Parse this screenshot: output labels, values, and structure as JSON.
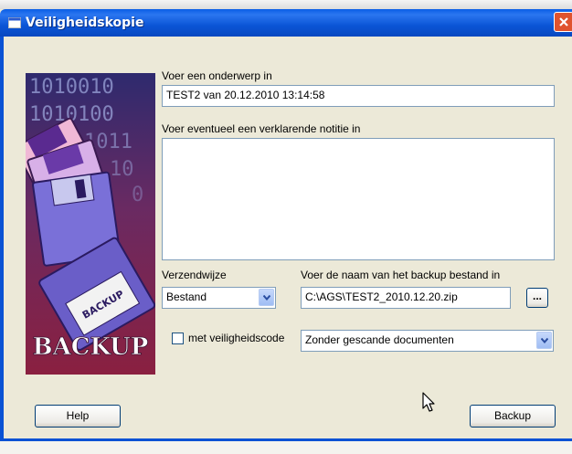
{
  "window": {
    "title": "Veiligheidskopie"
  },
  "form": {
    "subject_label": "Voer een onderwerp in",
    "subject_value": "TEST2 van 20.12.2010 13:14:58",
    "note_label": "Voer eventueel een verklarende notitie in",
    "note_value": "",
    "method_label": "Verzendwijze",
    "method_value": "Bestand",
    "filename_label": "Voer de naam van het backup bestand in",
    "filename_value": "C:\\AGS\\TEST2_2010.12.20.zip",
    "browse_label": "...",
    "security_checkbox_label": "met veiligheidscode",
    "security_checked": false,
    "scan_option_value": "Zonder gescande documenten"
  },
  "art": {
    "binary_row1": "1010010",
    "binary_row2": "1010100",
    "binary_row3": "1011",
    "binary_row4": "10",
    "binary_row5": "0",
    "disk_label": "BACKUP",
    "banner_text": "BACKUP"
  },
  "buttons": {
    "help_label": "Help",
    "backup_label": "Backup"
  },
  "colors": {
    "titlebar": "#0b55d6",
    "art_background": "#7a2140",
    "art_banner": "#ffffff"
  },
  "icons": {
    "title_icon": "window-icon",
    "close_icon": "close-icon",
    "dropdown_icon": "chevron-down-icon",
    "cursor_icon": "mouse-pointer-icon"
  }
}
